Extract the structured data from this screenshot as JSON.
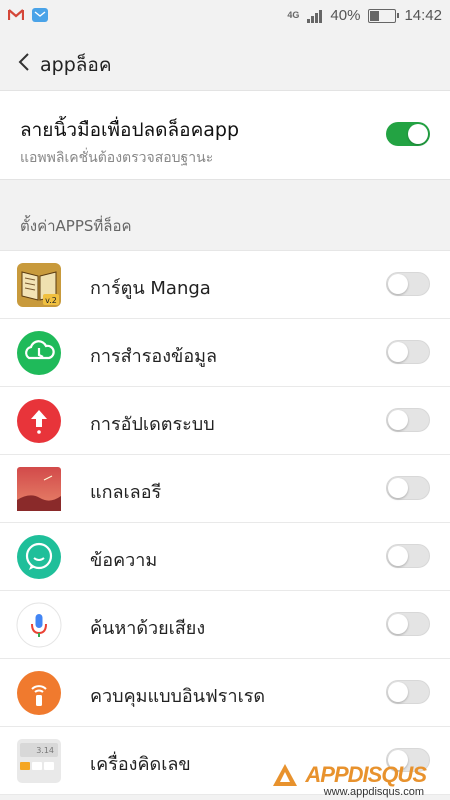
{
  "status_bar": {
    "network": "4G",
    "battery": "40%",
    "battery_level": 0.4,
    "time": "14:42"
  },
  "header": {
    "title": "appล็อค"
  },
  "fingerprint": {
    "title": "ลายนิ้วมือเพื่อปลดล็อคapp",
    "subtitle": "แอพพลิเคชั่นต้องตรวจสอบฐานะ",
    "enabled": true
  },
  "section": {
    "label": "ตั้งค่าAPPSที่ล็อค"
  },
  "apps": [
    {
      "label": "การ์ตูน Manga",
      "icon": "manga-book-icon",
      "locked": false
    },
    {
      "label": "การสำรองข้อมูล",
      "icon": "cloud-backup-icon",
      "locked": false
    },
    {
      "label": "การอัปเดตระบบ",
      "icon": "system-update-icon",
      "locked": false
    },
    {
      "label": "แกลเลอรี",
      "icon": "gallery-icon",
      "locked": false
    },
    {
      "label": "ข้อความ",
      "icon": "messages-icon",
      "locked": false
    },
    {
      "label": "ค้นหาด้วยเสียง",
      "icon": "voice-search-icon",
      "locked": false
    },
    {
      "label": "ควบคุมแบบอินฟราเรด",
      "icon": "infrared-remote-icon",
      "locked": false
    },
    {
      "label": "เครื่องคิดเลข",
      "icon": "calculator-icon",
      "locked": false
    }
  ],
  "watermark": {
    "text": "APPDISQUS",
    "url": "www.appdisqus.com"
  },
  "colors": {
    "toggle_on": "#23a343",
    "toggle_off": "#e4e4e4",
    "background": "#f2f2f2"
  }
}
